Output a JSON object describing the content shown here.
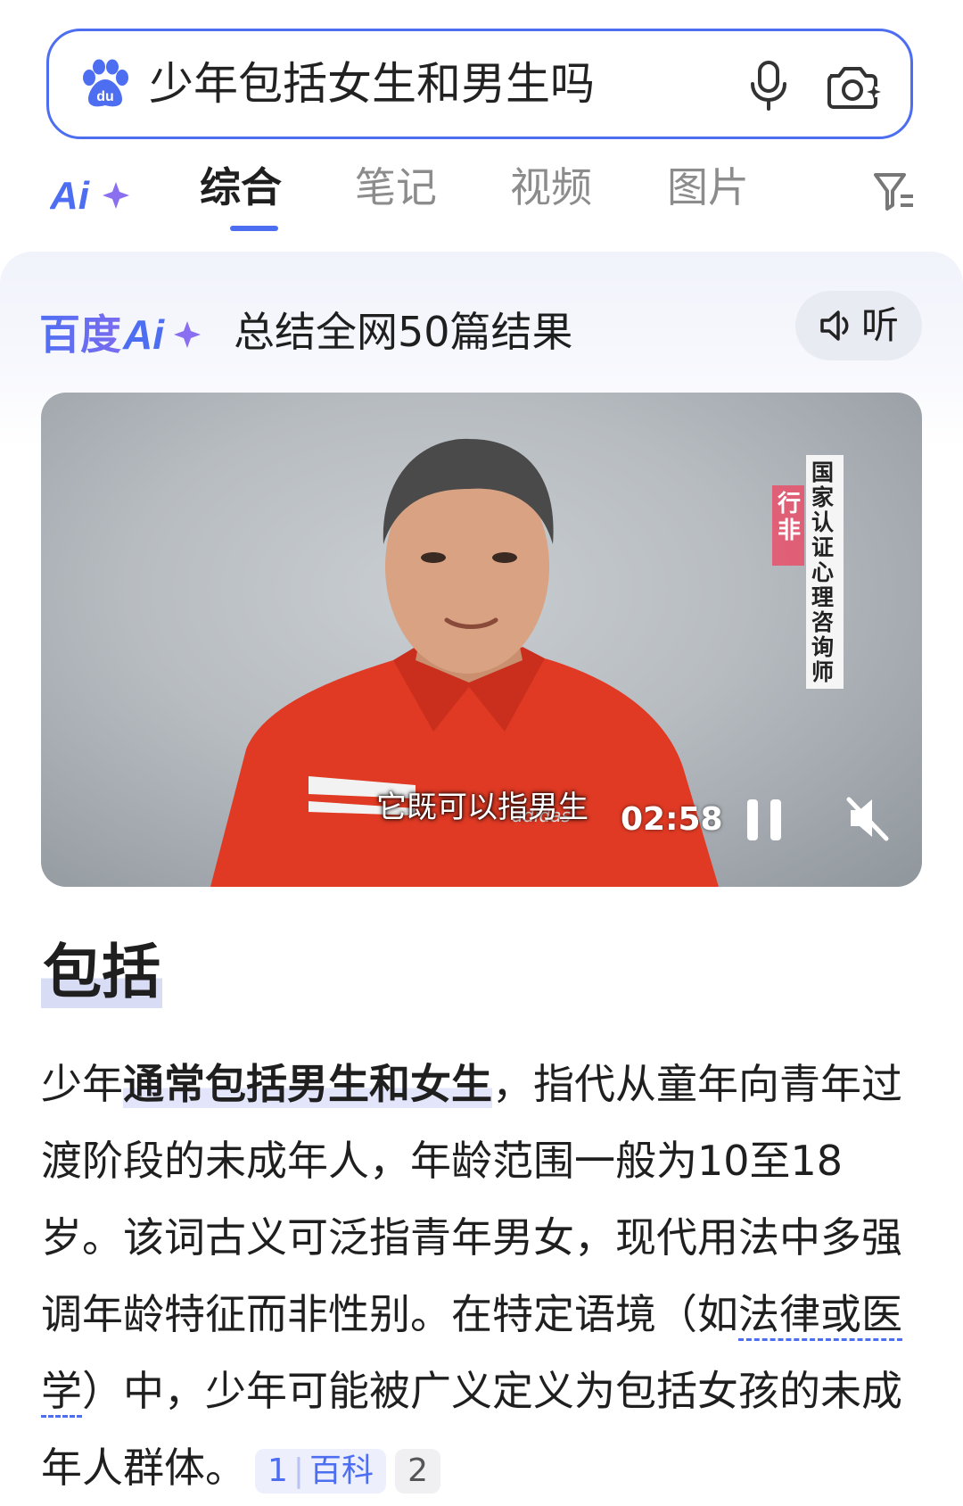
{
  "search": {
    "query": "少年包括女生和男生吗"
  },
  "tabs": {
    "ai_label": "Ai+",
    "items": [
      {
        "label": "综合",
        "active": true
      },
      {
        "label": "笔记",
        "active": false
      },
      {
        "label": "视频",
        "active": false
      },
      {
        "label": "图片",
        "active": false
      }
    ]
  },
  "ai_card": {
    "logo_text": "百度Ai+",
    "summary": "总结全网50篇结果",
    "listen_label": "听"
  },
  "video": {
    "subtitle": "它既可以指男生",
    "time": "02:58",
    "badge_left": "行非",
    "badge_right": "国家认证心理咨询师",
    "shirt_brand": "adidas"
  },
  "answer": {
    "heading": "包括",
    "p1": "少年",
    "p1_highlight": "通常包括男生和女生",
    "p2": "，指代从童年向青年过渡阶段的未成年人，年龄范围一般为10至18岁。该词古义可泛指青年男女，现代用法中多强调年龄特征而非性别。在特定语境（如",
    "p2_dashed": "法律或医学",
    "p3": "）中，少年可能被广义定义为包括女孩的未成年人群体。",
    "cite1_num": "1",
    "cite1_label": "百科",
    "cite2_num": "2"
  },
  "colors": {
    "accent": "#4e6ef2",
    "pink_accent": "#e8506b",
    "shirt_red": "#e03a24"
  }
}
